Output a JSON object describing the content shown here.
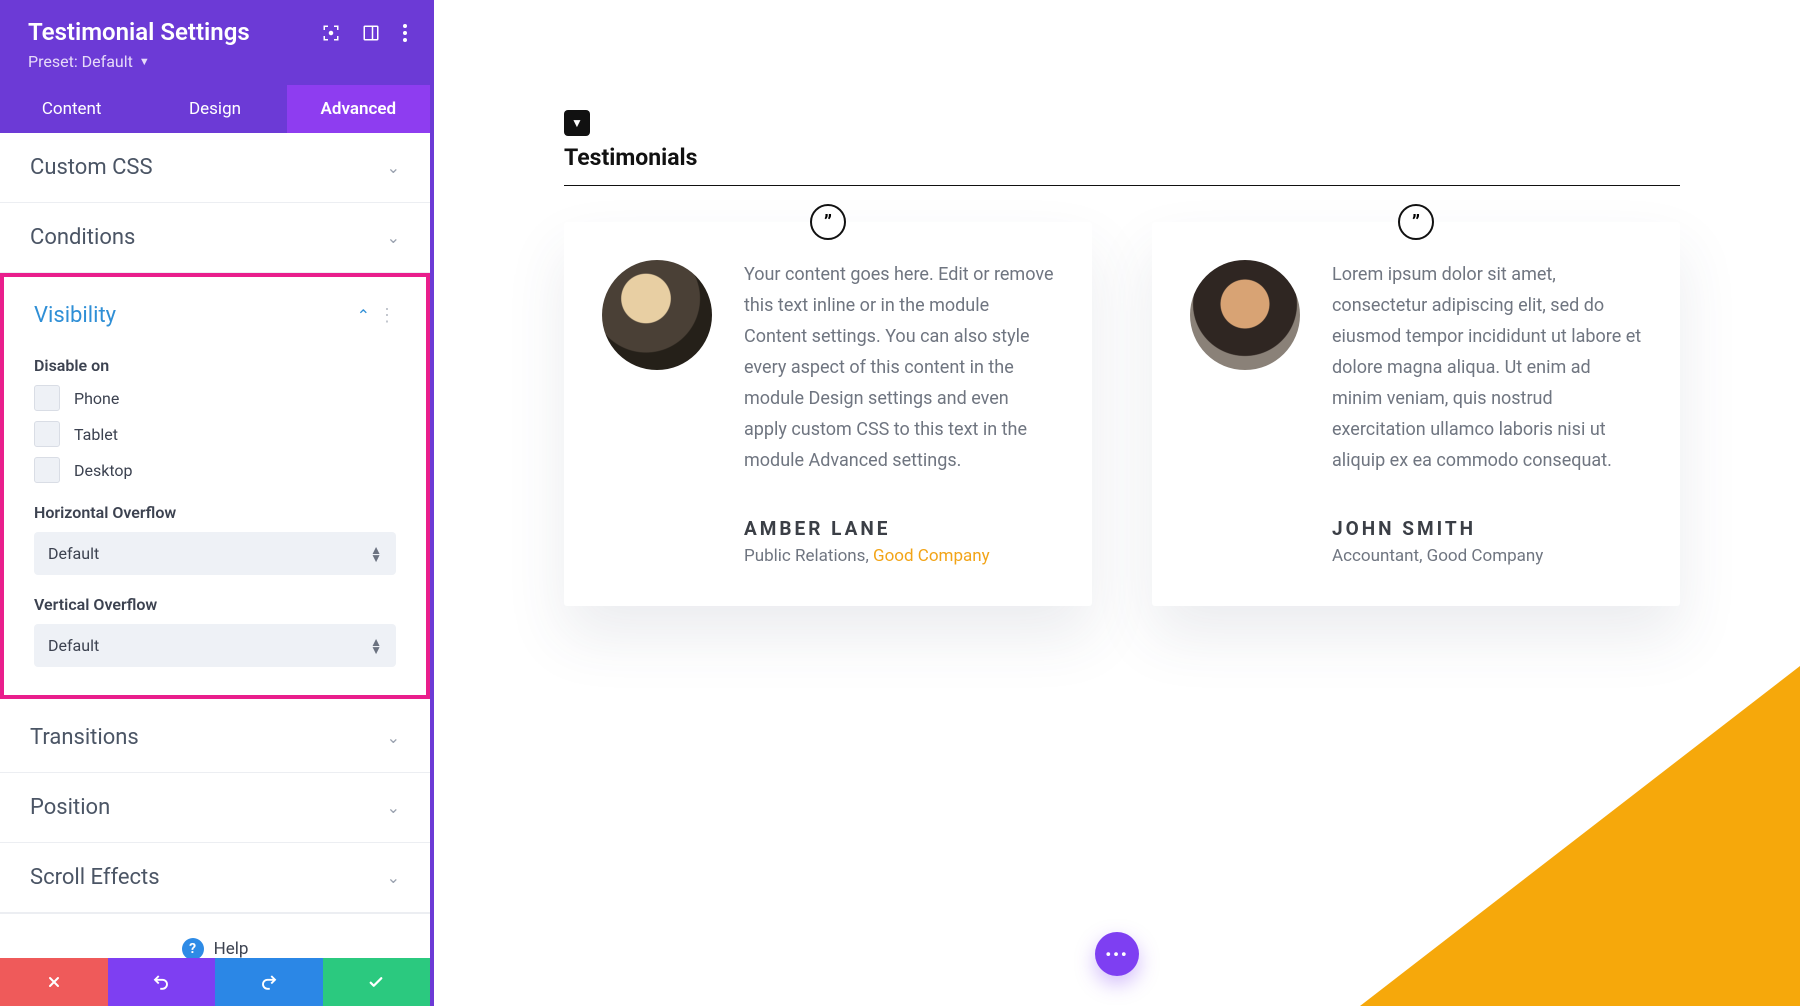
{
  "panel": {
    "title": "Testimonial Settings",
    "preset_label": "Preset: Default"
  },
  "tabs": {
    "content": "Content",
    "design": "Design",
    "advanced": "Advanced",
    "active": "advanced"
  },
  "sections": {
    "custom_css": "Custom CSS",
    "conditions": "Conditions",
    "visibility": "Visibility",
    "transitions": "Transitions",
    "position": "Position",
    "scroll_effects": "Scroll Effects"
  },
  "visibility": {
    "disable_on_label": "Disable on",
    "options": {
      "phone": "Phone",
      "tablet": "Tablet",
      "desktop": "Desktop"
    },
    "h_overflow_label": "Horizontal Overflow",
    "h_overflow_value": "Default",
    "v_overflow_label": "Vertical Overflow",
    "v_overflow_value": "Default"
  },
  "help_label": "Help",
  "preview": {
    "heading": "Testimonials",
    "cards": [
      {
        "text": "Your content goes here. Edit or remove this text inline or in the module Content settings. You can also style every aspect of this content in the module Design settings and even apply custom CSS to this text in the module Advanced settings.",
        "name": "AMBER LANE",
        "role": "Public Relations, ",
        "company": "Good Company",
        "company_linked": true
      },
      {
        "text": "Lorem ipsum dolor sit amet, consectetur adipiscing elit, sed do eiusmod tempor incididunt ut labore et dolore magna aliqua. Ut enim ad minim veniam, quis nostrud exercitation ullamco laboris nisi ut aliquip ex ea commodo consequat.",
        "name": "JOHN SMITH",
        "role": "Accountant, Good Company",
        "company": "",
        "company_linked": false
      }
    ]
  },
  "colors": {
    "accent": "#f6a80b",
    "link": "#f2a417",
    "purple": "#7e3ff2",
    "highlight": "#e91e8c"
  }
}
